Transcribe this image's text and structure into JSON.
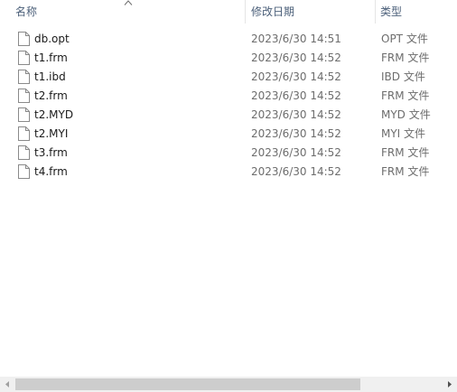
{
  "columns": {
    "name": "名称",
    "date_modified": "修改日期",
    "type": "类型"
  },
  "files": [
    {
      "name": "db.opt",
      "date": "2023/6/30 14:51",
      "type": "OPT 文件"
    },
    {
      "name": "t1.frm",
      "date": "2023/6/30 14:52",
      "type": "FRM 文件"
    },
    {
      "name": "t1.ibd",
      "date": "2023/6/30 14:52",
      "type": "IBD 文件"
    },
    {
      "name": "t2.frm",
      "date": "2023/6/30 14:52",
      "type": "FRM 文件"
    },
    {
      "name": "t2.MYD",
      "date": "2023/6/30 14:52",
      "type": "MYD 文件"
    },
    {
      "name": "t2.MYI",
      "date": "2023/6/30 14:52",
      "type": "MYI 文件"
    },
    {
      "name": "t3.frm",
      "date": "2023/6/30 14:52",
      "type": "FRM 文件"
    },
    {
      "name": "t4.frm",
      "date": "2023/6/30 14:52",
      "type": "FRM 文件"
    }
  ],
  "icons": {
    "file": "file-icon",
    "sort": "sort-ascending-icon",
    "scroll_left": "scroll-left-arrow-icon",
    "scroll_right": "scroll-right-arrow-icon"
  },
  "colors": {
    "header_text": "#4c607a",
    "secondary_text": "#6d6d6d",
    "scrollbar_track": "#f0f0f0",
    "scrollbar_thumb": "#cdcdcd"
  }
}
